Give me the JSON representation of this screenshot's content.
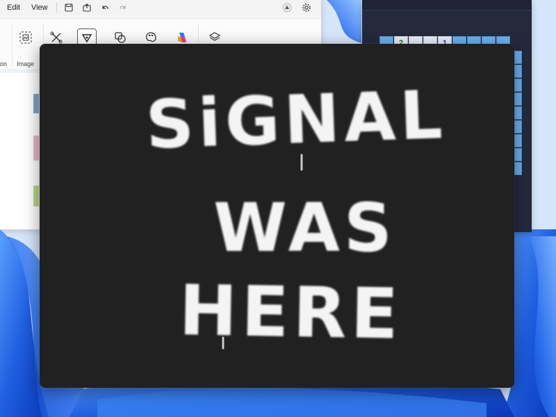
{
  "paint": {
    "menu": [
      "Edit",
      "View"
    ],
    "ribbon_labels": [
      "on",
      "Image"
    ],
    "icons": [
      "save-icon",
      "share-icon",
      "undo-icon",
      "redo-icon",
      "profile-icon",
      "settings-icon",
      "image-select-icon",
      "brush-tools-icon",
      "pencil-icon",
      "shapes-icon",
      "color-palette-icon",
      "copilot-icon",
      "layers-icon"
    ]
  },
  "game": {
    "top_row": [
      {
        "state": "hidden",
        "text": ""
      },
      {
        "state": "open",
        "text": "2"
      },
      {
        "state": "open",
        "text": ""
      },
      {
        "state": "open",
        "text": ""
      },
      {
        "state": "open",
        "text": "1"
      },
      {
        "state": "hidden",
        "text": ""
      },
      {
        "state": "hidden",
        "text": ""
      },
      {
        "state": "hidden",
        "text": ""
      },
      {
        "state": "hidden",
        "text": ""
      }
    ],
    "colors": {
      "hidden": "#6cb0ee",
      "open": "#e9eef7",
      "background": "#242a3c"
    }
  },
  "overlay": {
    "lines": [
      "SiGNAL",
      "WAS",
      "HERE"
    ],
    "colors": {
      "background": "#212121",
      "text": "#f4f4f4"
    }
  },
  "wallpaper": {
    "colors": {
      "light": "#dbe9fb",
      "mid": "#3b7fe8",
      "deep": "#0b3fc6"
    }
  }
}
